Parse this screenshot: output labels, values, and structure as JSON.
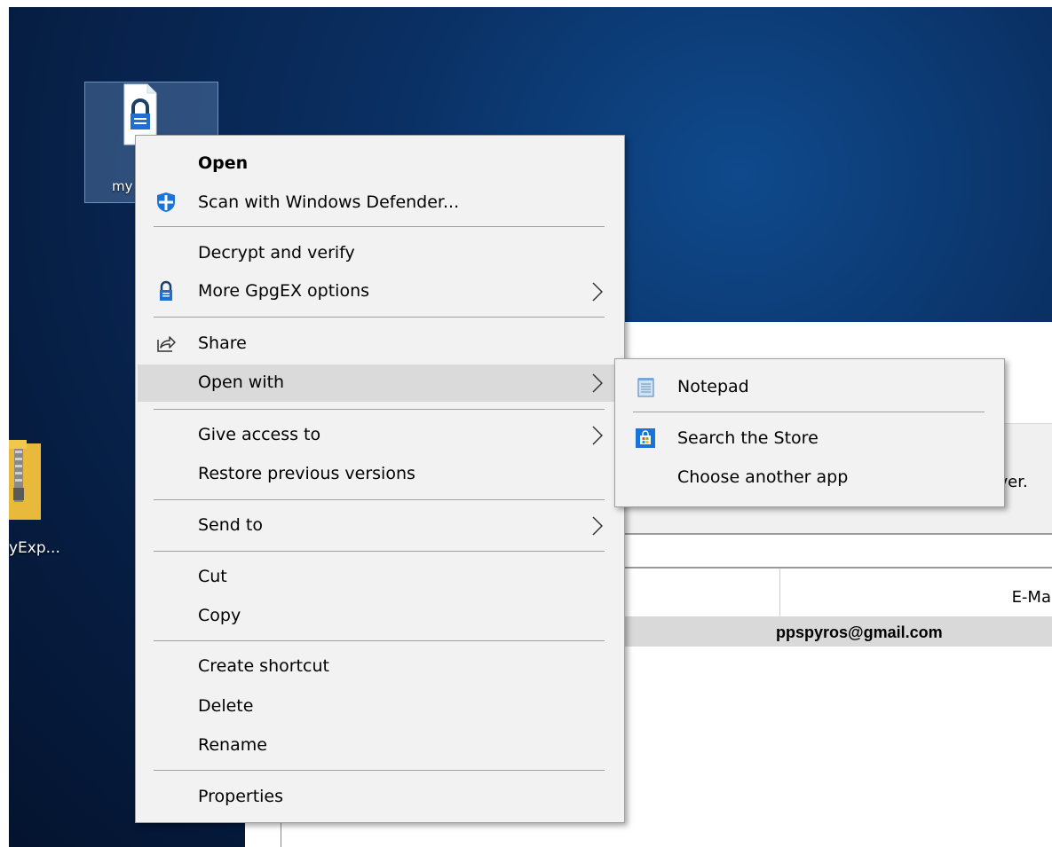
{
  "desktop": {
    "file_icon_label": "my",
    "zip_icon_label": "yExp..."
  },
  "background_window": {
    "truncated_text": "erver.",
    "email_column_header": "E-Mai",
    "selected_email": "ppspyros@gmail.com"
  },
  "context_menu": {
    "items": [
      {
        "label": "Open",
        "icon": "none",
        "bold": true
      },
      {
        "label": "Scan with Windows Defender...",
        "icon": "defender-shield-icon"
      },
      {
        "label": "Decrypt and verify",
        "icon": "none"
      },
      {
        "label": "More GpgEX options",
        "icon": "gpg-lock-icon",
        "submenu": true
      },
      {
        "label": "Share",
        "icon": "share-icon"
      },
      {
        "label": "Open with",
        "icon": "none",
        "submenu": true,
        "highlighted": true
      },
      {
        "label": "Give access to",
        "icon": "none",
        "submenu": true
      },
      {
        "label": "Restore previous versions",
        "icon": "none"
      },
      {
        "label": "Send to",
        "icon": "none",
        "submenu": true
      },
      {
        "label": "Cut",
        "icon": "none"
      },
      {
        "label": "Copy",
        "icon": "none"
      },
      {
        "label": "Create shortcut",
        "icon": "none"
      },
      {
        "label": "Delete",
        "icon": "none"
      },
      {
        "label": "Rename",
        "icon": "none"
      },
      {
        "label": "Properties",
        "icon": "none"
      }
    ]
  },
  "open_with_submenu": {
    "items": [
      {
        "label": "Notepad",
        "icon": "notepad-icon"
      },
      {
        "label": "Search the Store",
        "icon": "store-icon"
      },
      {
        "label": "Choose another app",
        "icon": "none"
      }
    ]
  },
  "colors": {
    "menu_background": "#f2f2f2",
    "menu_highlight": "#dadada",
    "desktop_blue": "#0a2f62",
    "defender_blue": "#1a73d8"
  }
}
